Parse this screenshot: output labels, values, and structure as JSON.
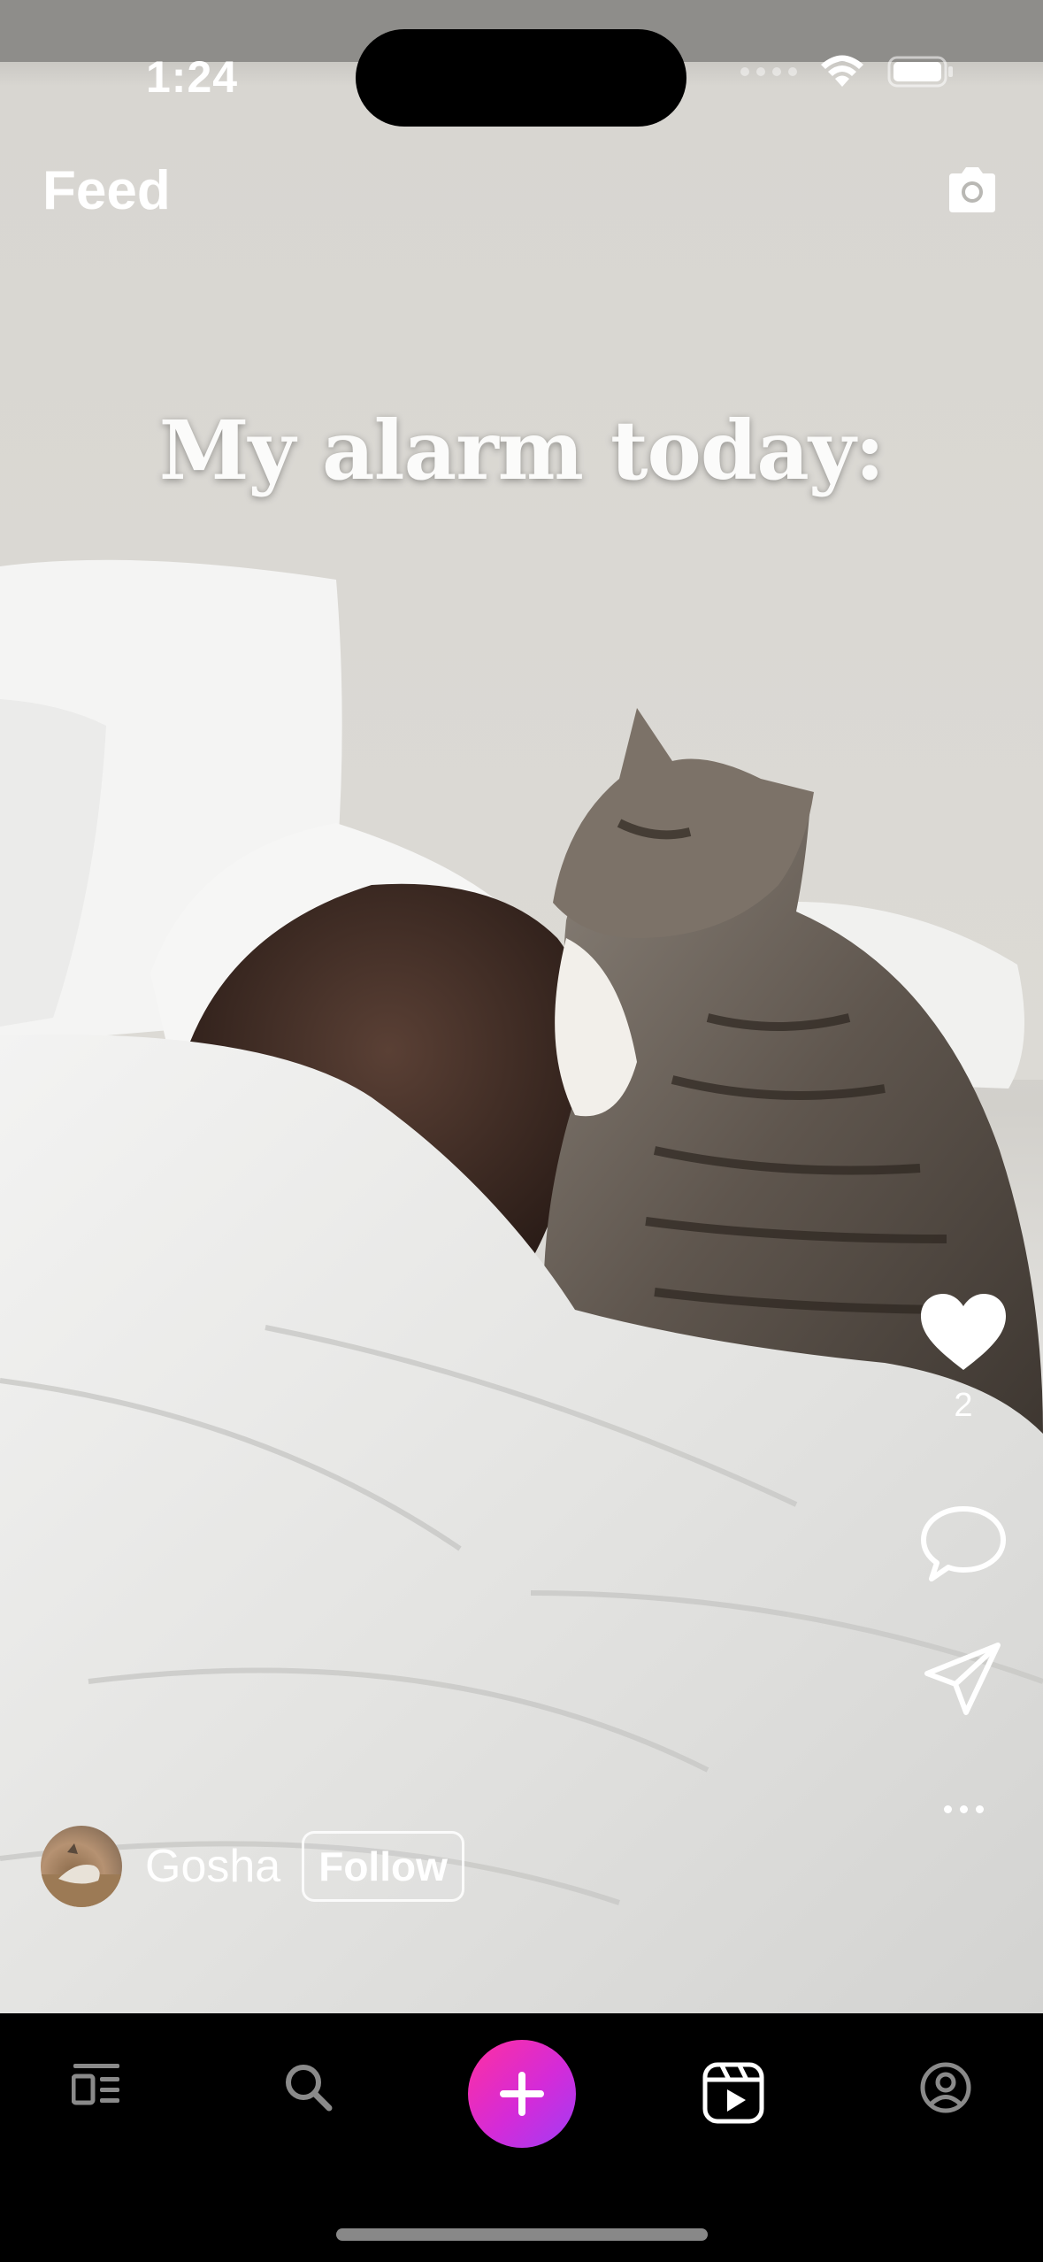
{
  "status_bar": {
    "time": "1:24"
  },
  "header": {
    "title": "Feed",
    "camera_icon": "camera-icon"
  },
  "post": {
    "caption": "My alarm today:",
    "likes": "2",
    "author": {
      "name": "Gosha",
      "follow_label": "Follow"
    },
    "actions": [
      "heart-icon",
      "comment-icon",
      "share-icon",
      "more-icon"
    ]
  },
  "tab_bar": {
    "items": [
      "feed-icon",
      "search-icon",
      "create-icon",
      "reels-icon",
      "profile-icon"
    ],
    "active": "reels-icon",
    "accent": "#d42bd8"
  }
}
